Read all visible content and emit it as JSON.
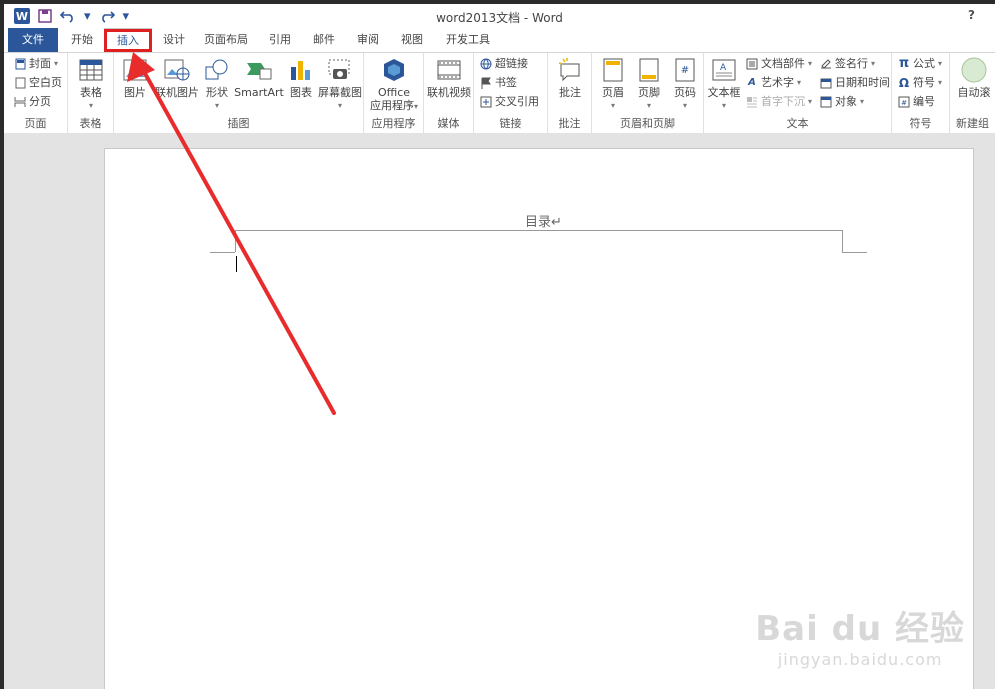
{
  "window": {
    "title": "word2013文档 - Word",
    "help": "?"
  },
  "qat": {
    "logo": "W",
    "save": "save-icon",
    "undo": "undo-icon",
    "redo": "redo-icon",
    "customize": "▾"
  },
  "tabs": {
    "file": "文件",
    "home": "开始",
    "insert": "插入",
    "design": "设计",
    "layout": "页面布局",
    "references": "引用",
    "mailings": "邮件",
    "review": "审阅",
    "view": "视图",
    "developer": "开发工具"
  },
  "ribbon": {
    "pages": {
      "label": "页面",
      "cover": "封面",
      "blank": "空白页",
      "break": "分页"
    },
    "tables": {
      "label": "表格",
      "table": "表格"
    },
    "illustrations": {
      "label": "插图",
      "picture": "图片",
      "online_picture": "联机图片",
      "shapes": "形状",
      "smartart": "SmartArt",
      "chart": "图表",
      "screenshot": "屏幕截图"
    },
    "apps": {
      "label": "应用程序",
      "office": "Office",
      "apps_for": "应用程序"
    },
    "media": {
      "label": "媒体",
      "online_video": "联机视频"
    },
    "links": {
      "label": "链接",
      "hyperlink": "超链接",
      "bookmark": "书签",
      "cross_ref": "交叉引用"
    },
    "comments": {
      "label": "批注",
      "comment": "批注"
    },
    "header_footer": {
      "label": "页眉和页脚",
      "header": "页眉",
      "footer": "页脚",
      "page_number": "页码"
    },
    "text": {
      "label": "文本",
      "textbox": "文本框",
      "quick_parts": "文档部件",
      "wordart": "艺术字",
      "drop_cap": "首字下沉",
      "signature": "签名行",
      "datetime": "日期和时间",
      "object": "对象"
    },
    "symbols": {
      "label": "符号",
      "equation": "公式",
      "symbol": "符号",
      "numbering": "编号"
    },
    "new_group": {
      "label": "新建组",
      "auto_scroll": "自动滚"
    }
  },
  "document": {
    "header_text": "目录↵"
  },
  "watermark": {
    "line1": "Bai du 经验",
    "line2": "jingyan.baidu.com"
  },
  "colors": {
    "accent": "#2b579a",
    "annotation": "#e02020"
  }
}
